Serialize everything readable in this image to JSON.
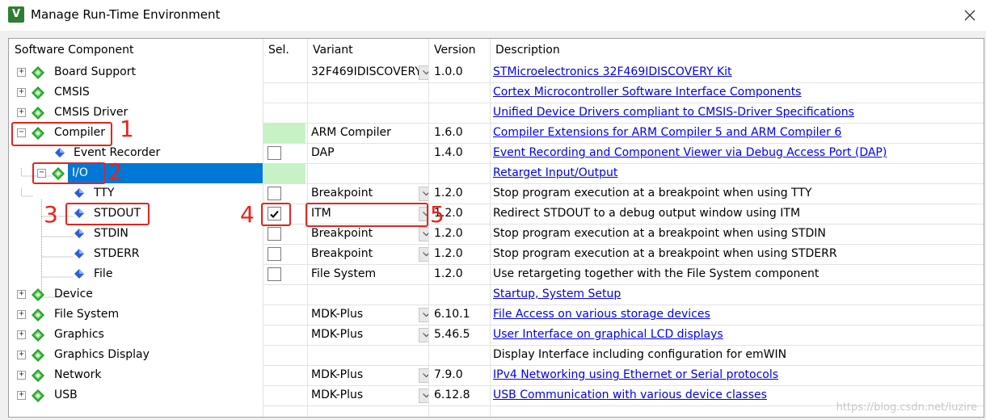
{
  "window": {
    "title": "Manage Run-Time Environment",
    "icon": "app-logo-icon",
    "close_icon": "close-icon"
  },
  "columns": {
    "component": "Software Component",
    "sel": "Sel.",
    "variant": "Variant",
    "version": "Version",
    "description": "Description"
  },
  "rows": [
    {
      "label": "Board Support",
      "variant": "32F469IDISCOVERY",
      "version": "1.0.0",
      "desc": "STMicroelectronics 32F469IDISCOVERY Kit",
      "desc_link": true
    },
    {
      "label": "CMSIS",
      "variant": "",
      "version": "",
      "desc": "Cortex Microcontroller Software Interface Components",
      "desc_link": true
    },
    {
      "label": "CMSIS Driver",
      "variant": "",
      "version": "",
      "desc": "Unified Device Drivers compliant to CMSIS-Driver Specifications",
      "desc_link": true
    },
    {
      "label": "Compiler",
      "variant": "ARM Compiler",
      "version": "1.6.0",
      "desc": "Compiler Extensions for ARM Compiler 5 and ARM Compiler 6",
      "desc_link": true
    },
    {
      "label": "Event Recorder",
      "variant": "DAP",
      "version": "1.4.0",
      "desc": "Event Recording and Component Viewer via Debug Access Port (DAP)",
      "desc_link": true
    },
    {
      "label": "I/O",
      "variant": "",
      "version": "",
      "desc": "Retarget Input/Output",
      "desc_link": true
    },
    {
      "label": "TTY",
      "variant": "Breakpoint",
      "version": "1.2.0",
      "desc": "Stop program execution at a breakpoint when using TTY",
      "desc_link": false
    },
    {
      "label": "STDOUT",
      "variant": "ITM",
      "version": "1.2.0",
      "desc": "Redirect STDOUT to a debug output window using ITM",
      "desc_link": false
    },
    {
      "label": "STDIN",
      "variant": "Breakpoint",
      "version": "1.2.0",
      "desc": "Stop program execution at a breakpoint when using STDIN",
      "desc_link": false
    },
    {
      "label": "STDERR",
      "variant": "Breakpoint",
      "version": "1.2.0",
      "desc": "Stop program execution at a breakpoint when using STDERR",
      "desc_link": false
    },
    {
      "label": "File",
      "variant": "File System",
      "version": "1.2.0",
      "desc": "Use retargeting together with the File System component",
      "desc_link": false
    },
    {
      "label": "Device",
      "variant": "",
      "version": "",
      "desc": "Startup, System Setup",
      "desc_link": true
    },
    {
      "label": "File System",
      "variant": "MDK-Plus",
      "version": "6.10.1",
      "desc": "File Access on various storage devices",
      "desc_link": true
    },
    {
      "label": "Graphics",
      "variant": "MDK-Plus",
      "version": "5.46.5",
      "desc": "User Interface on graphical LCD displays",
      "desc_link": true
    },
    {
      "label": "Graphics Display",
      "variant": "",
      "version": "",
      "desc": "Display Interface including configuration for emWIN",
      "desc_link": false
    },
    {
      "label": "Network",
      "variant": "MDK-Plus",
      "version": "7.9.0",
      "desc": "IPv4 Networking using Ethernet or Serial protocols",
      "desc_link": true
    },
    {
      "label": "USB",
      "variant": "MDK-Plus",
      "version": "6.12.8",
      "desc": "USB Communication with various device classes",
      "desc_link": true
    }
  ],
  "annotations": [
    "1",
    "2",
    "3",
    "4",
    "5"
  ],
  "watermark": "https://blog.csdn.net/luzire",
  "colors": {
    "selection": "#0078d7",
    "annotation_red": "#e8231b",
    "green_sel": "#c6f2c6",
    "link": "#0000ee"
  }
}
